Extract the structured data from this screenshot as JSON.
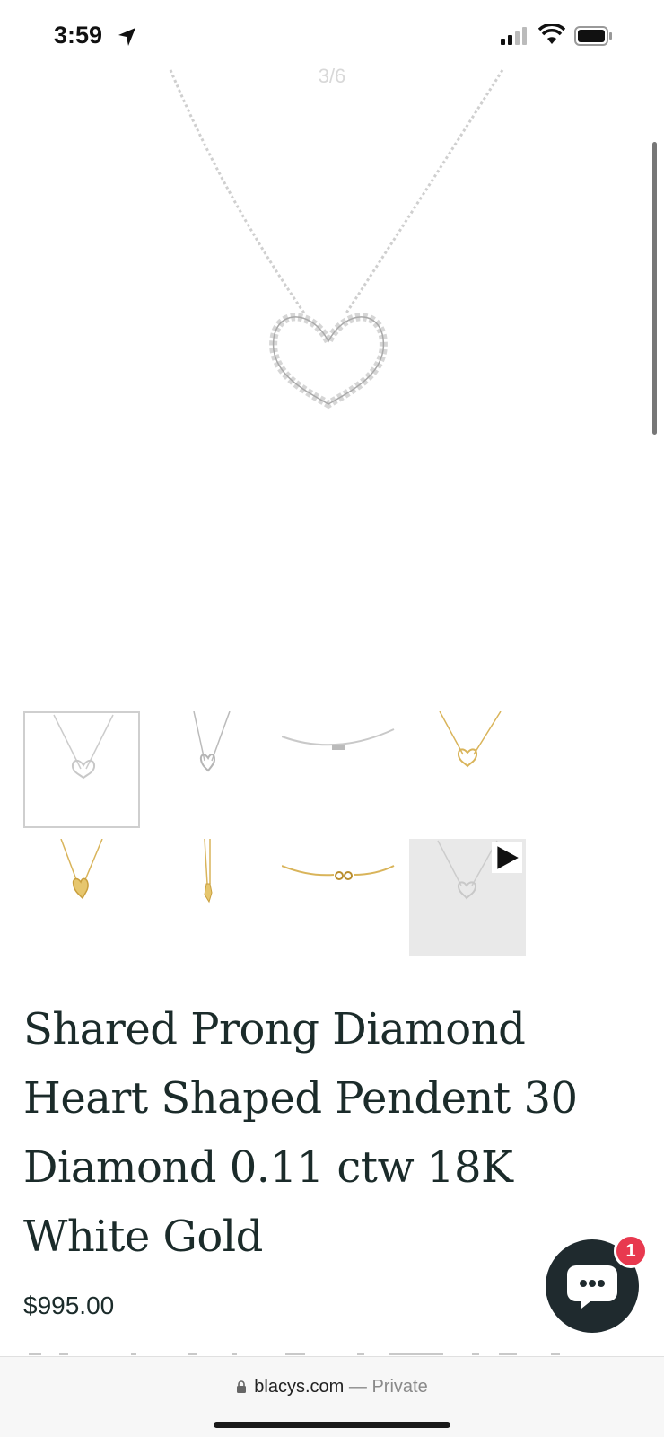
{
  "status_bar": {
    "time": "3:59"
  },
  "gallery": {
    "counter": "3/6"
  },
  "thumbnails": [
    {
      "name": "thumb-1-white-heart"
    },
    {
      "name": "thumb-2-white-heart-side"
    },
    {
      "name": "thumb-3-white-chain"
    },
    {
      "name": "thumb-4-gold-heart"
    },
    {
      "name": "thumb-5-gold-heart-angled"
    },
    {
      "name": "thumb-6-gold-heart-side"
    },
    {
      "name": "thumb-7-gold-clasp"
    },
    {
      "name": "thumb-8-video"
    }
  ],
  "product": {
    "title_line1": "Shared Prong Diamond",
    "title_line2": "Heart Shaped Pendent 30",
    "title_line3": "Diamond 0.11 ctw 18K",
    "title_line4": "White Gold",
    "price": "$995.00"
  },
  "chat": {
    "badge_count": "1"
  },
  "browser": {
    "domain": "blacys.com",
    "separator": " — ",
    "mode": "Private"
  },
  "colors": {
    "accent_dark": "#1f2a2e",
    "badge_red": "#e8394f",
    "gold": "#d9b45a",
    "silver": "#c7c7c7"
  }
}
